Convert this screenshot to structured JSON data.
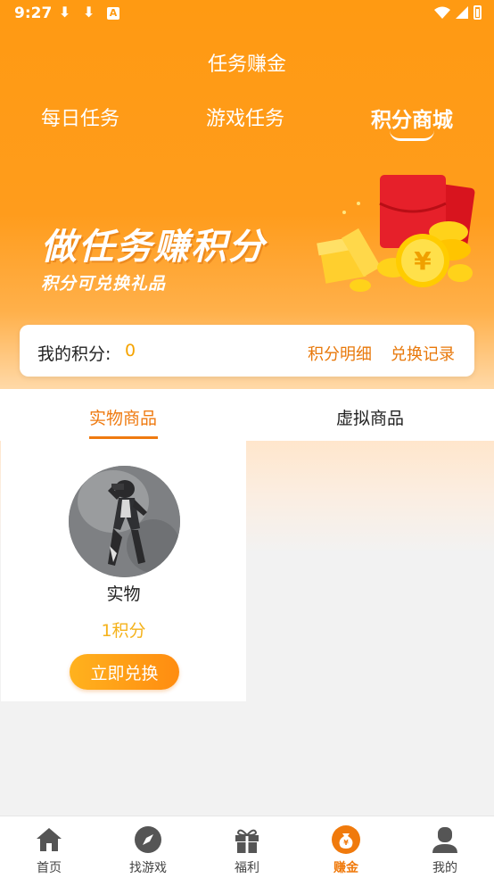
{
  "status_bar": {
    "time": "9:27",
    "download_glyph": "⬇",
    "a_badge": "A"
  },
  "header": {
    "title": "任务赚金",
    "tabs": [
      {
        "label": "每日任务"
      },
      {
        "label": "游戏任务"
      },
      {
        "label": "积分商城"
      }
    ]
  },
  "banner": {
    "title": "做任务赚积分",
    "subtitle": "积分可兑换礼品",
    "yen_glyph": "¥"
  },
  "points": {
    "label": "我的积分:",
    "value": "0",
    "detail_link": "积分明细",
    "history_link": "兑换记录"
  },
  "categories": [
    {
      "label": "实物商品"
    },
    {
      "label": "虚拟商品"
    }
  ],
  "products": [
    {
      "name": "实物",
      "price": "1积分",
      "button": "立即兑换"
    }
  ],
  "bottom_nav": [
    {
      "label": "首页",
      "icon": "home-icon"
    },
    {
      "label": "找游戏",
      "icon": "compass-icon"
    },
    {
      "label": "福利",
      "icon": "gift-icon"
    },
    {
      "label": "赚金",
      "icon": "money-bag-icon"
    },
    {
      "label": "我的",
      "icon": "user-icon"
    }
  ],
  "colors": {
    "brand_orange": "#ff9a12",
    "accent_orange": "#ef7a10",
    "price_yellow": "#f5b21a"
  }
}
